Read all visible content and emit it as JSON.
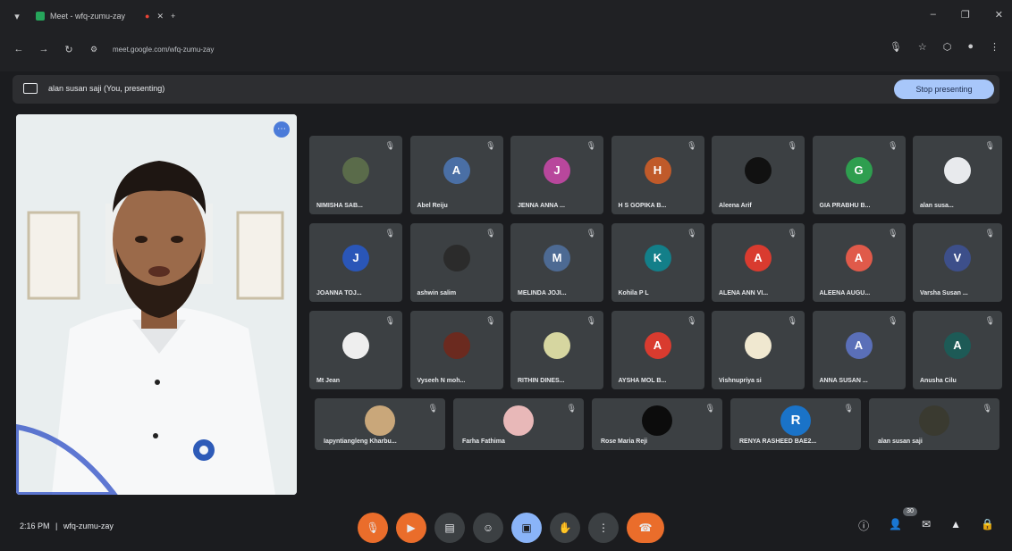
{
  "browser": {
    "tab_title": "Meet - wfq-zumu-zay",
    "url": "meet.google.com/wfq-zumu-zay",
    "icons": [
      "back-icon",
      "forward-icon",
      "reload-icon",
      "site-info-icon",
      "mic-icon",
      "star-icon",
      "extension-icon",
      "profile-icon",
      "menu-icon"
    ]
  },
  "presenting_bar": {
    "text": "alan susan saji (You, presenting)",
    "stop_label": "Stop presenting"
  },
  "participants": [
    {
      "name": "NIMISHA SAB...",
      "initial": "",
      "color": "#5a6b4a"
    },
    {
      "name": "Abel Reiju",
      "initial": "A",
      "color": "#4a6fa5"
    },
    {
      "name": "JENNA ANNA ...",
      "initial": "J",
      "color": "#b8479c"
    },
    {
      "name": "H S GOPIKA B...",
      "initial": "H",
      "color": "#c05a2a"
    },
    {
      "name": "Aleena Arif",
      "initial": "",
      "color": "#111111"
    },
    {
      "name": "GIA PRABHU B...",
      "initial": "G",
      "color": "#2e9e4f"
    },
    {
      "name": "alan susa...",
      "initial": "",
      "color": "#e8eaed"
    },
    {
      "name": "JOANNA TOJ...",
      "initial": "J",
      "color": "#2a56b8"
    },
    {
      "name": "ashwin salim",
      "initial": "",
      "color": "#2b2b2b"
    },
    {
      "name": "MELINDA JOJI...",
      "initial": "M",
      "color": "#4d6a93"
    },
    {
      "name": "Kohila P L",
      "initial": "K",
      "color": "#137f89"
    },
    {
      "name": "ALENA ANN VI...",
      "initial": "A",
      "color": "#d93b2f"
    },
    {
      "name": "ALEENA AUGU...",
      "initial": "A",
      "color": "#e05a4a"
    },
    {
      "name": "Varsha Susan ...",
      "initial": "V",
      "color": "#3d4f8a"
    },
    {
      "name": "Mt Jean",
      "initial": "",
      "color": "#eeeeee"
    },
    {
      "name": "Vyseeh N moh...",
      "initial": "",
      "color": "#6b2a1f"
    },
    {
      "name": "RITHIN DINES...",
      "initial": "",
      "color": "#d6d6a0"
    },
    {
      "name": "AYSHA MOL B...",
      "initial": "A",
      "color": "#d93b2f"
    },
    {
      "name": "Vishnupriya si",
      "initial": "",
      "color": "#f0e8d0"
    },
    {
      "name": "ANNA SUSAN ...",
      "initial": "A",
      "color": "#5a6fb8"
    },
    {
      "name": "Anusha Cilu",
      "initial": "A",
      "color": "#1d5a56"
    },
    {
      "name": "Iapyntiangleng Kharbu...",
      "initial": "",
      "color": "#c9a77a"
    },
    {
      "name": "Farha Fathima",
      "initial": "",
      "color": "#e8b8b8"
    },
    {
      "name": "Rose Maria Reji",
      "initial": "",
      "color": "#0c0c0c"
    },
    {
      "name": "RENYA RASHEED BAE2...",
      "initial": "R",
      "color": "#1a73c8"
    },
    {
      "name": "alan susan saji",
      "initial": "",
      "color": "#3a3a30"
    }
  ],
  "bottom": {
    "time": "2:16 PM",
    "separator": "|",
    "meeting_code": "wfq-zumu-zay",
    "participant_count": "30"
  }
}
